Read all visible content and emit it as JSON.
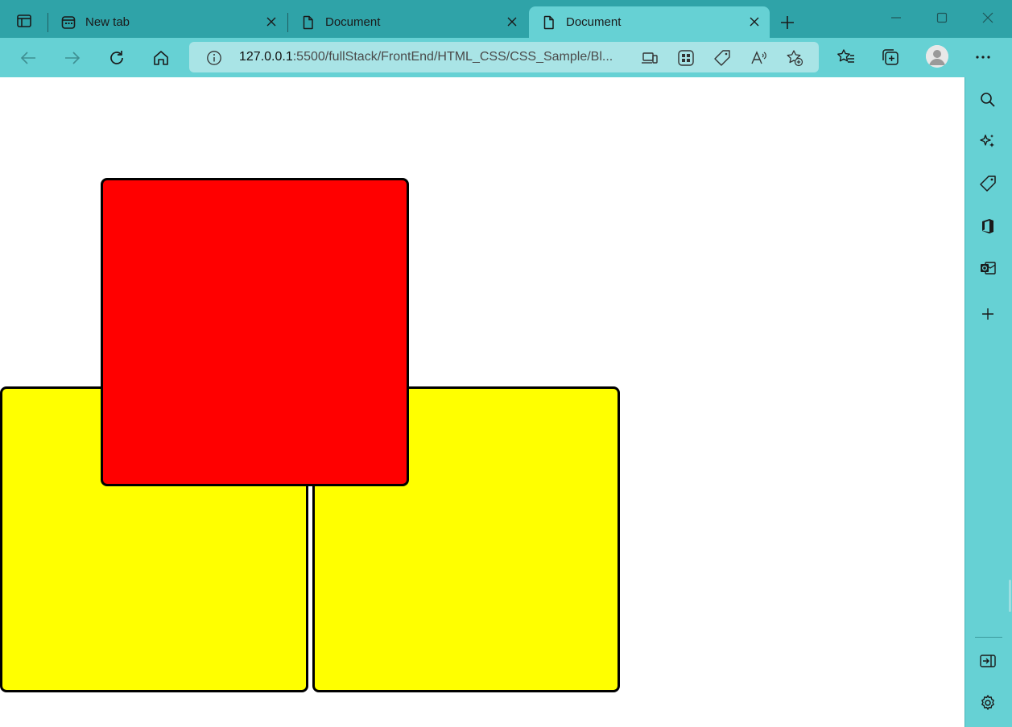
{
  "browser": {
    "tabs": [
      {
        "label": "New tab",
        "icon": "new-tab-page-icon",
        "active": false
      },
      {
        "label": "Document",
        "icon": "document-icon",
        "active": false
      },
      {
        "label": "Document",
        "icon": "document-icon",
        "active": true
      }
    ],
    "address_bar": {
      "url_host": "127.0.0.1",
      "url_rest": ":5500/fullStack/FrontEnd/HTML_CSS/CSS_Sample/Bl..."
    },
    "toolbar_icons": [
      "back-icon",
      "forward-icon",
      "refresh-icon",
      "home-icon",
      "info-icon",
      "devices-icon",
      "apps-icon",
      "tag-icon",
      "read-aloud-icon",
      "add-favorite-icon",
      "favorites-icon",
      "collections-icon",
      "profile-icon",
      "more-icon"
    ],
    "sidebar_icons": [
      "search-icon",
      "copilot-icon",
      "shopping-tag-icon",
      "office-icon",
      "outlook-icon",
      "add-icon",
      "hide-sidebar-icon",
      "settings-icon"
    ]
  },
  "page": {
    "colors": {
      "yellow": "#ffff00",
      "red": "#ff0000",
      "border": "#000000"
    }
  }
}
